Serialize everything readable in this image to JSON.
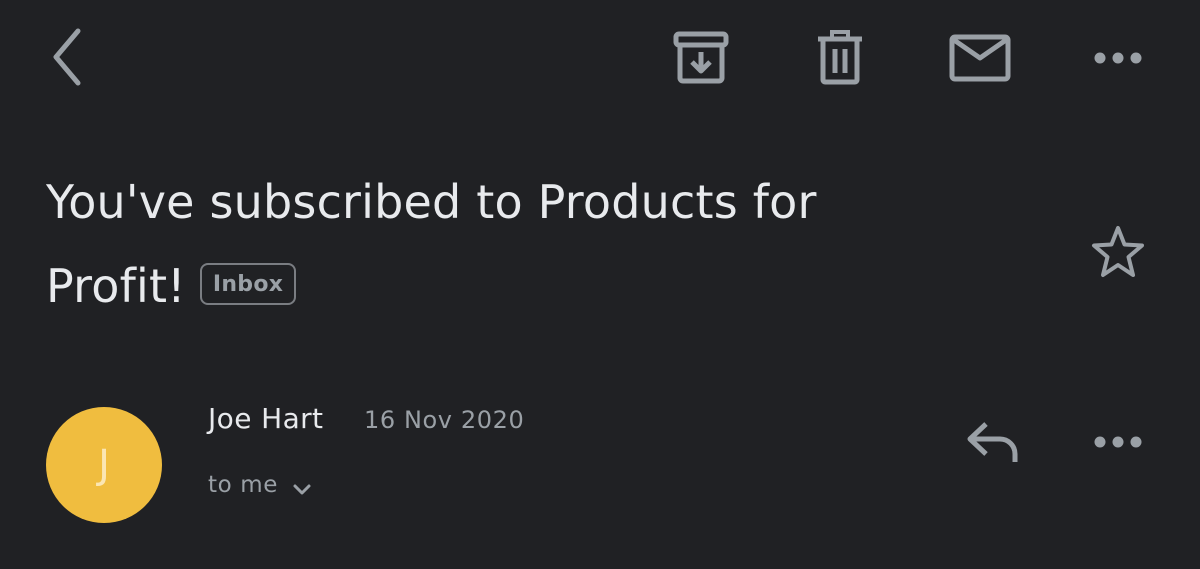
{
  "email": {
    "subject": "You've subscribed to Products for Profit!",
    "label": "Inbox"
  },
  "message": {
    "avatar_letter": "J",
    "sender_name": "Joe Hart",
    "date": "16 Nov 2020",
    "recipient": "to me"
  },
  "colors": {
    "background": "#202124",
    "avatar": "#f0bd3f",
    "icon": "#9aa0a6"
  },
  "icons": {
    "back": "back-arrow-icon",
    "archive": "archive-icon",
    "delete": "trash-icon",
    "mark_unread": "mail-icon",
    "more": "more-horizontal-icon",
    "star": "star-icon",
    "reply": "reply-icon",
    "expand": "chevron-down-icon"
  }
}
